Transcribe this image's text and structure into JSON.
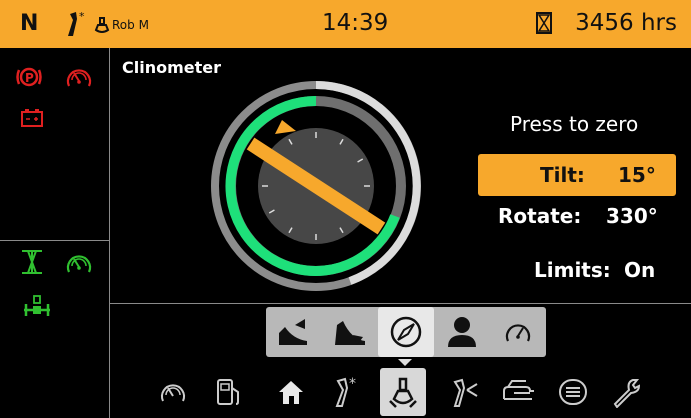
{
  "status_bar": {
    "gear": "N",
    "user": "Rob M",
    "time": "14:39",
    "hours": "3456 hrs"
  },
  "screen": {
    "title": "Clinometer",
    "press_to_zero": "Press to zero"
  },
  "readouts": {
    "tilt_label": "Tilt:",
    "tilt_value": "15°",
    "rotate_label": "Rotate:",
    "rotate_value": "330°",
    "limits_label": "Limits:",
    "limits_value": "On"
  },
  "dial": {
    "tilt_deg": 15,
    "rotate_deg": 330
  },
  "left_indicators": [
    {
      "icon": "parking-brake-icon",
      "color": "#e02020"
    },
    {
      "icon": "speedometer-warning-icon",
      "color": "#e02020"
    },
    {
      "icon": "battery-icon",
      "color": "#e02020"
    },
    {
      "icon": "axle-lock-icon",
      "color": "#30c030"
    },
    {
      "icon": "speedometer-icon",
      "color": "#30c030"
    },
    {
      "icon": "axle-locked-icon",
      "color": "#30c030"
    }
  ],
  "sub_tabs": [
    "tilt-up-icon",
    "tilt-down-icon",
    "compass-icon",
    "operator-icon",
    "gauge-icon"
  ],
  "active_sub_tab": "compass-icon",
  "bottom_nav": [
    "speedometer-icon",
    "fuel-icon",
    "home-icon",
    "joystick-icon",
    "machine-settings-icon",
    "attachment-icon",
    "hand-icon",
    "menu-icon",
    "wrench-icon"
  ],
  "active_nav": "machine-settings-icon",
  "colors": {
    "accent": "#f7a82c",
    "ok": "#1ee07a",
    "warn": "#e02020",
    "active_green": "#30c030"
  }
}
